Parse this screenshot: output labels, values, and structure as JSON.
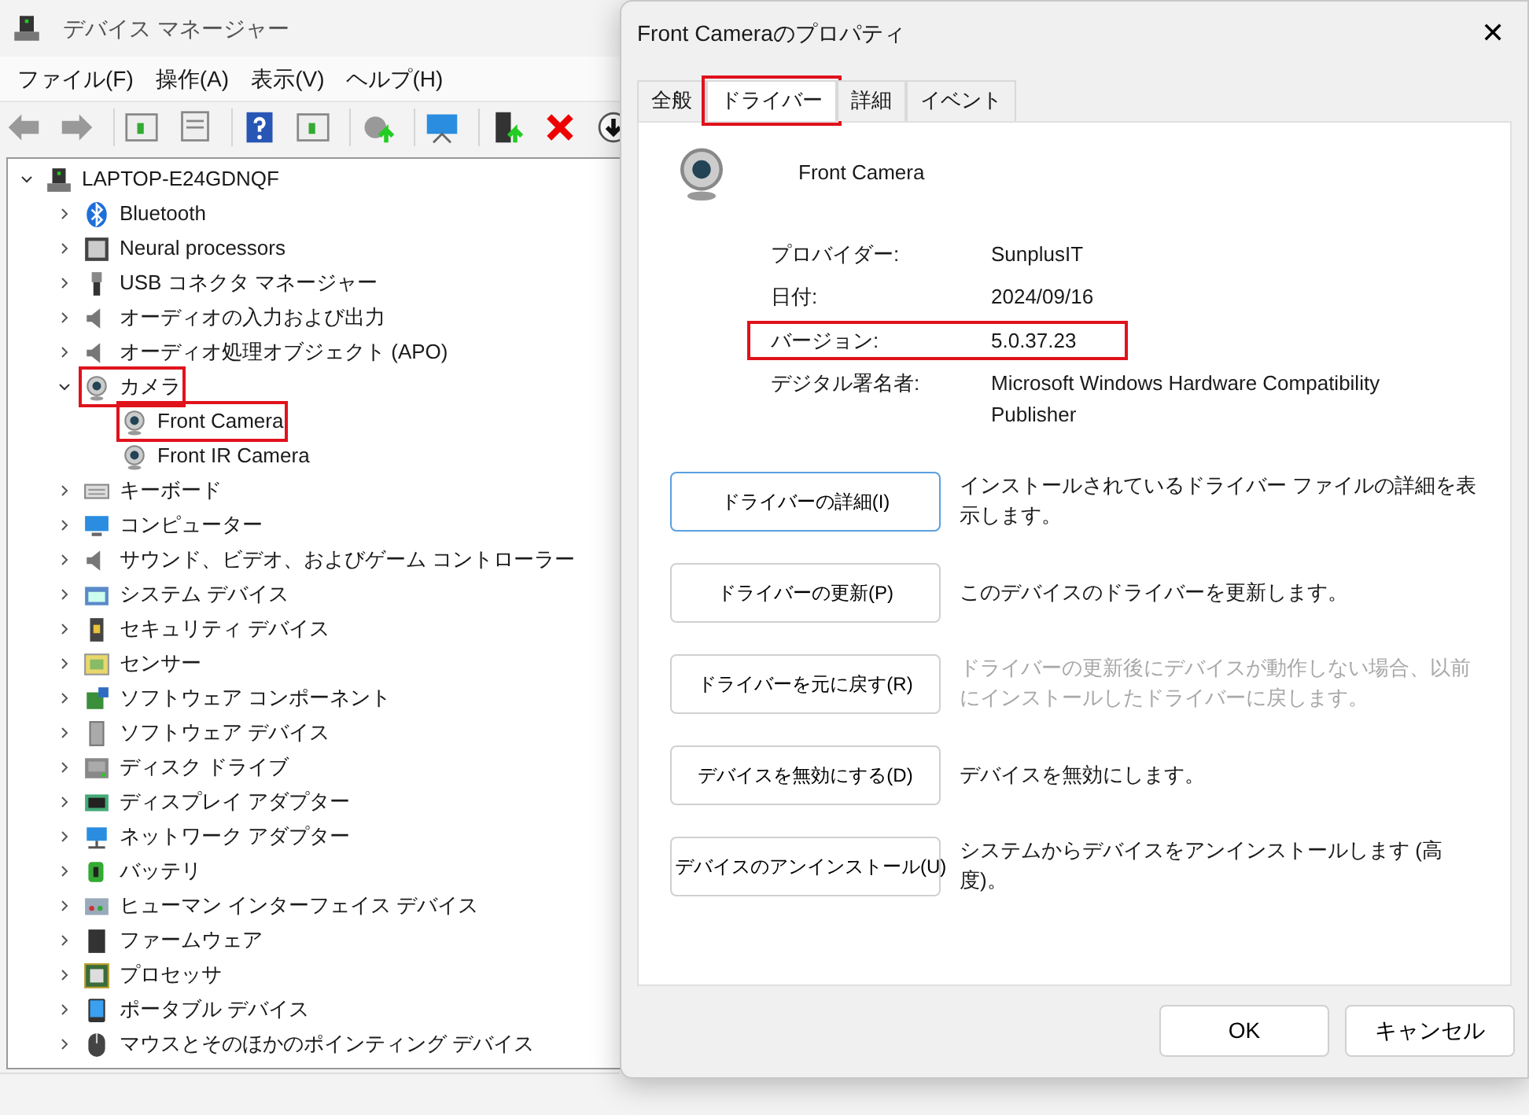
{
  "window": {
    "title": "デバイス マネージャー"
  },
  "menu": [
    "ファイル(F)",
    "操作(A)",
    "表示(V)",
    "ヘルプ(H)"
  ],
  "toolbar": [
    {
      "kind": "back"
    },
    {
      "kind": "forward"
    },
    {
      "kind": "panel"
    },
    {
      "kind": "properties"
    },
    {
      "kind": "help"
    },
    {
      "kind": "panel"
    },
    {
      "kind": "update"
    },
    {
      "kind": "scan"
    },
    {
      "kind": "enable"
    },
    {
      "kind": "uninstall"
    },
    {
      "kind": "download"
    }
  ],
  "tree": [
    {
      "label": "LAPTOP-E24GDNQF",
      "expanded": true,
      "children": [
        {
          "label": "Bluetooth",
          "expanded": false
        },
        {
          "label": "Neural processors",
          "expanded": false
        },
        {
          "label": "USB コネクタ マネージャー",
          "expanded": false
        },
        {
          "label": "オーディオの入力および出力",
          "expanded": false
        },
        {
          "label": "オーディオ処理オブジェクト (APO)",
          "expanded": false
        },
        {
          "label": "カメラ",
          "expanded": true,
          "highlighted": true,
          "children": [
            {
              "label": "Front Camera",
              "highlighted": true
            },
            {
              "label": "Front IR Camera",
              "highlighted": false
            }
          ]
        },
        {
          "label": "キーボード",
          "expanded": false
        },
        {
          "label": "コンピューター",
          "expanded": false
        },
        {
          "label": "サウンド、ビデオ、およびゲーム コントローラー",
          "expanded": false
        },
        {
          "label": "システム デバイス",
          "expanded": false
        },
        {
          "label": "セキュリティ デバイス",
          "expanded": false
        },
        {
          "label": "センサー",
          "expanded": false
        },
        {
          "label": "ソフトウェア コンポーネント",
          "expanded": false
        },
        {
          "label": "ソフトウェア デバイス",
          "expanded": false
        },
        {
          "label": "ディスク ドライブ",
          "expanded": false
        },
        {
          "label": "ディスプレイ アダプター",
          "expanded": false
        },
        {
          "label": "ネットワーク アダプター",
          "expanded": false
        },
        {
          "label": "バッテリ",
          "expanded": false
        },
        {
          "label": "ヒューマン インターフェイス デバイス",
          "expanded": false
        },
        {
          "label": "ファームウェア",
          "expanded": false
        },
        {
          "label": "プロセッサ",
          "expanded": false
        },
        {
          "label": "ポータブル デバイス",
          "expanded": false
        },
        {
          "label": "マウスとそのほかのポインティング デバイス",
          "expanded": false
        }
      ]
    }
  ],
  "dialog": {
    "title": "Front Cameraのプロパティ",
    "close": "✕",
    "tabs": [
      {
        "label": "全般",
        "selected": false,
        "highlighted": false
      },
      {
        "label": "ドライバー",
        "selected": true,
        "highlighted": true
      },
      {
        "label": "詳細",
        "selected": false,
        "highlighted": false
      },
      {
        "label": "イベント",
        "selected": false,
        "highlighted": false
      }
    ],
    "device_name": "Front Camera",
    "properties": [
      {
        "label": "プロバイダー:",
        "value": "SunplusIT",
        "highlighted": false
      },
      {
        "label": "日付:",
        "value": "2024/09/16",
        "highlighted": false
      },
      {
        "label": "バージョン:",
        "value": "5.0.37.23",
        "highlighted": true
      },
      {
        "label": "デジタル署名者:",
        "value": "Microsoft Windows Hardware Compatibility Publisher",
        "highlighted": false
      }
    ],
    "actions": [
      {
        "button": "ドライバーの詳細(I)",
        "description": "インストールされているドライバー ファイルの詳細を表示します。",
        "focused": true,
        "disabled": false
      },
      {
        "button": "ドライバーの更新(P)",
        "description": "このデバイスのドライバーを更新します。",
        "focused": false,
        "disabled": false
      },
      {
        "button": "ドライバーを元に戻す(R)",
        "description": "ドライバーの更新後にデバイスが動作しない場合、以前にインストールしたドライバーに戻します。",
        "focused": false,
        "disabled": true
      },
      {
        "button": "デバイスを無効にする(D)",
        "description": "デバイスを無効にします。",
        "focused": false,
        "disabled": false
      },
      {
        "button": "デバイスのアンインストール(U)",
        "description": "システムからデバイスをアンインストールします (高度)。",
        "focused": false,
        "disabled": false
      }
    ],
    "buttons": [
      "OK",
      "キャンセル"
    ]
  }
}
